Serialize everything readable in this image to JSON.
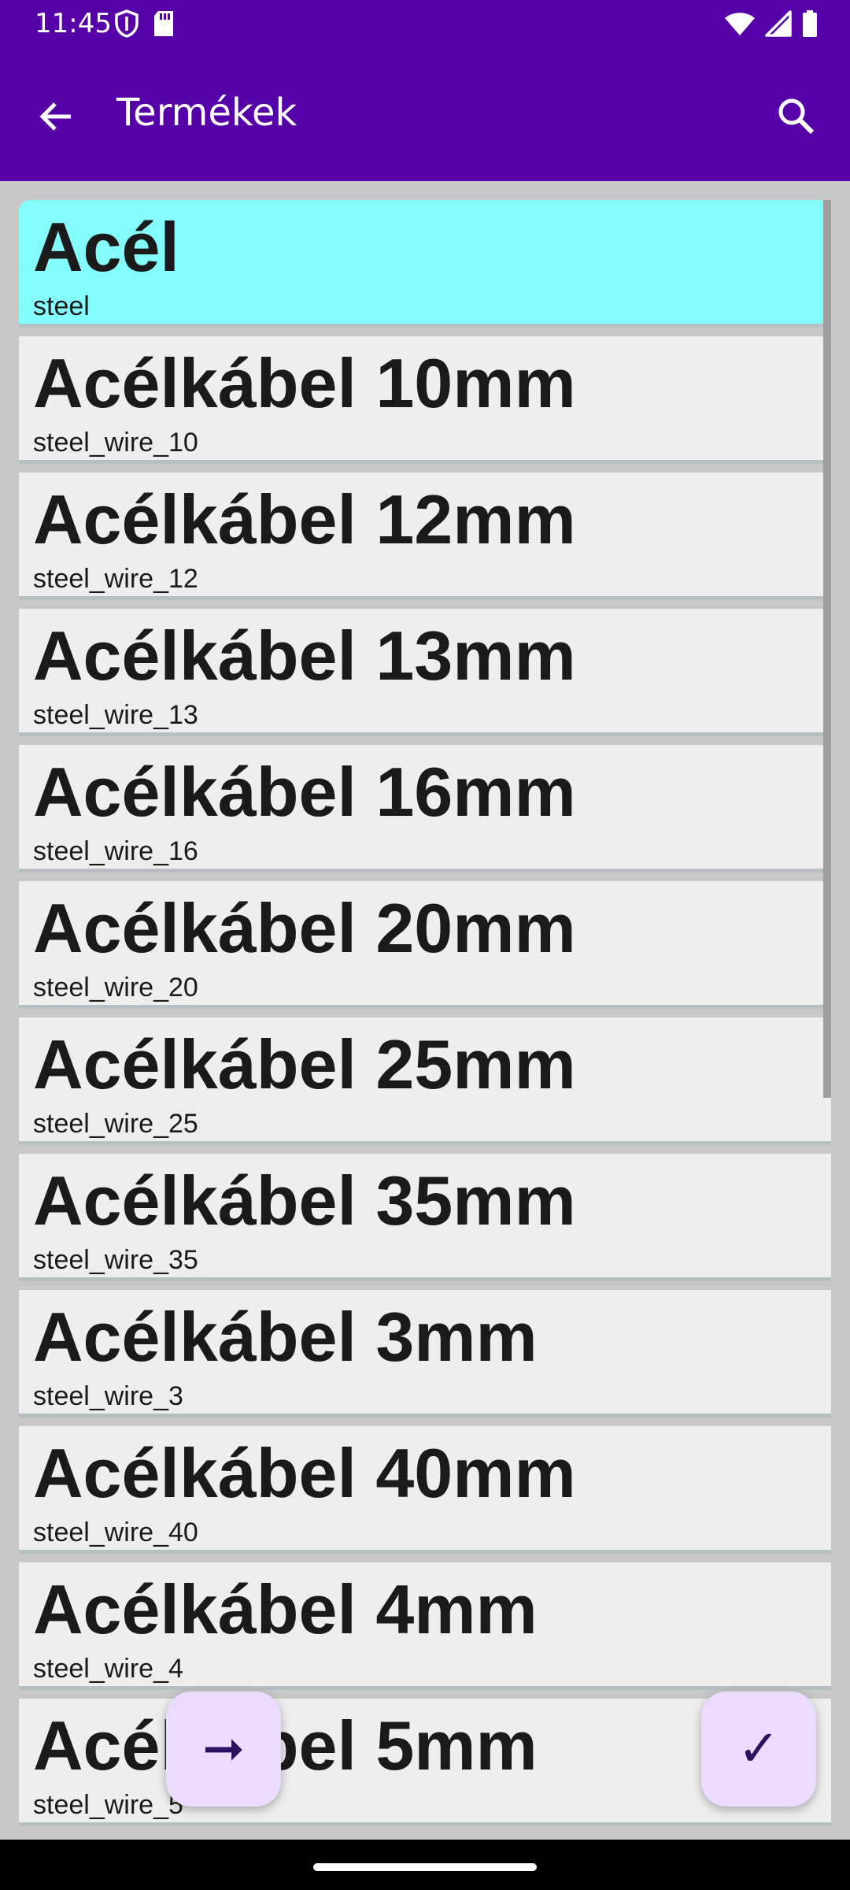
{
  "status_bar": {
    "time": "11:45",
    "left_icons": [
      "shield-icon",
      "sd-card-icon"
    ],
    "right_icons": [
      "wifi-icon",
      "signal-icon",
      "battery-icon"
    ]
  },
  "app_bar": {
    "title": "Termékek",
    "background_color": "#5600aa",
    "back_icon": "back-arrow-icon",
    "search_icon": "search-icon"
  },
  "products": [
    {
      "name": "Acél",
      "code": "steel",
      "selected": true
    },
    {
      "name": "Acélkábel 10mm",
      "code": "steel_wire_10"
    },
    {
      "name": "Acélkábel 12mm",
      "code": "steel_wire_12"
    },
    {
      "name": "Acélkábel 13mm",
      "code": "steel_wire_13"
    },
    {
      "name": "Acélkábel 16mm",
      "code": "steel_wire_16"
    },
    {
      "name": "Acélkábel 20mm",
      "code": "steel_wire_20"
    },
    {
      "name": "Acélkábel 25mm",
      "code": "steel_wire_25"
    },
    {
      "name": "Acélkábel 35mm",
      "code": "steel_wire_35"
    },
    {
      "name": "Acélkábel 3mm",
      "code": "steel_wire_3"
    },
    {
      "name": "Acélkábel 40mm",
      "code": "steel_wire_40"
    },
    {
      "name": "Acélkábel 4mm",
      "code": "steel_wire_4"
    },
    {
      "name": "Acélkábel 5mm",
      "code": "steel_wire_5"
    }
  ],
  "selected_color": "#84fcfc",
  "fab": {
    "next_glyph": "➞",
    "done_glyph": "✓",
    "background_color": "#ebdcff"
  }
}
